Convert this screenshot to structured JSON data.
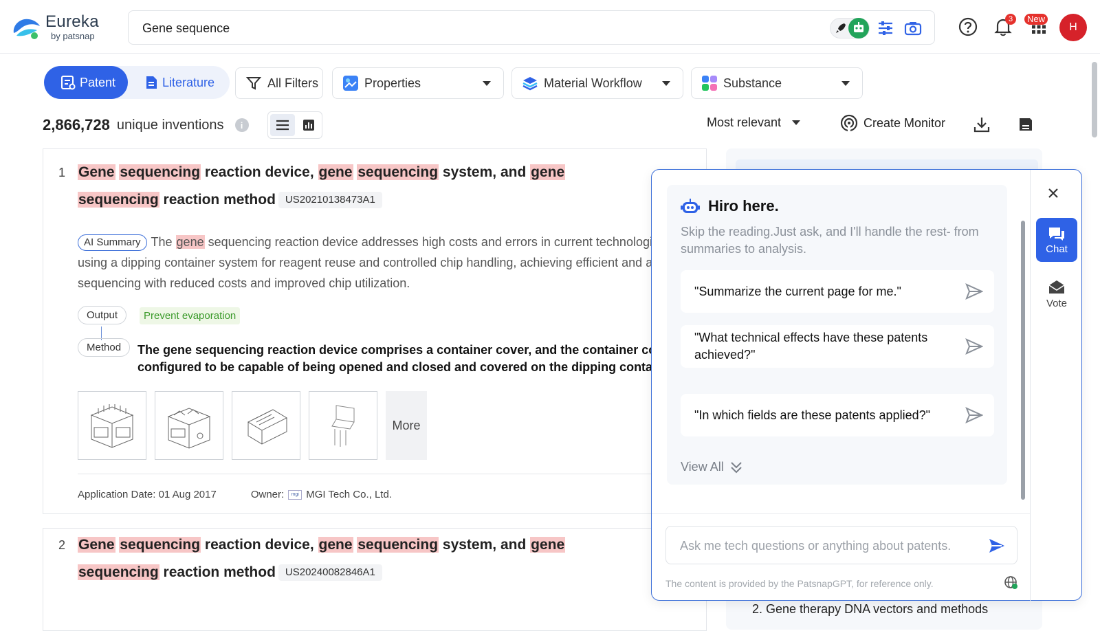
{
  "brand": {
    "name": "Eureka",
    "byline": "by patsnap"
  },
  "search": {
    "value": "Gene sequence"
  },
  "header": {
    "notification_count": "3",
    "apps_badge": "New",
    "avatar_initial": "H"
  },
  "toolbar": {
    "tabs": [
      {
        "label": "Patent",
        "active": true
      },
      {
        "label": "Literature",
        "active": false
      }
    ],
    "all_filters": "All Filters",
    "dropdowns": [
      "Properties",
      "Material Workflow",
      "Substance"
    ]
  },
  "results": {
    "count": "2,866,728",
    "count_label": "unique inventions",
    "sort": "Most relevant",
    "create_monitor": "Create Monitor",
    "items": [
      {
        "rank": "1",
        "title_parts": [
          {
            "t": "Gene",
            "hl": true
          },
          {
            "t": " ",
            "hl": false
          },
          {
            "t": "sequencing",
            "hl": true
          },
          {
            "t": " reaction device, ",
            "hl": false
          },
          {
            "t": "gene",
            "hl": true
          },
          {
            "t": " ",
            "hl": false
          },
          {
            "t": "sequencing",
            "hl": true
          },
          {
            "t": " system, and ",
            "hl": false
          },
          {
            "t": "gene",
            "hl": true
          },
          {
            "t": " ",
            "hl": false
          },
          {
            "t": "sequencing",
            "hl": true
          },
          {
            "t": " reaction method",
            "hl": false
          }
        ],
        "patent_number": "US20210138473A1",
        "ai_summary_label": "AI Summary",
        "summary_parts": [
          {
            "t": "The ",
            "hl": false
          },
          {
            "t": "gene",
            "hl": true
          },
          {
            "t": " sequencing reaction device addresses high costs and errors in current technologies using a dipping container system for reagent reuse and controlled chip handling, achieving efficient and acc",
            "hl": false
          },
          {
            "t": "gene",
            "hl": true
          },
          {
            "t": " sequencing with reduced costs and improved chip utilization.",
            "hl": false
          }
        ],
        "output_label": "Output",
        "output_value": "Prevent evaporation",
        "method_label": "Method",
        "method_text": "The gene sequencing reaction device comprises a container cover, and the container cove configured to be capable of being opened and closed and covered on the dipping contain",
        "more_label": "More",
        "application_date_label": "Application Date:",
        "application_date": "01 Aug 2017",
        "owner_label": "Owner:",
        "owner_logo_text": "mgi",
        "owner": "MGI Tech Co., Ltd."
      },
      {
        "rank": "2",
        "title_parts": [
          {
            "t": "Gene",
            "hl": true
          },
          {
            "t": " ",
            "hl": false
          },
          {
            "t": "sequencing",
            "hl": true
          },
          {
            "t": " reaction device, ",
            "hl": false
          },
          {
            "t": "gene",
            "hl": true
          },
          {
            "t": " ",
            "hl": false
          },
          {
            "t": "sequencing",
            "hl": true
          },
          {
            "t": " system, and ",
            "hl": false
          },
          {
            "t": "gene",
            "hl": true
          },
          {
            "t": " ",
            "hl": false
          },
          {
            "t": "sequencing",
            "hl": true
          },
          {
            "t": " reaction method",
            "hl": false
          }
        ],
        "patent_number": "US20240082846A1"
      }
    ]
  },
  "side_panel": {
    "underlying_item": "2. Gene therapy DNA vectors and methods"
  },
  "chat": {
    "title": "Hiro here.",
    "subtitle": "Skip the reading.Just ask, and I'll handle the rest- from summaries to analysis.",
    "suggestions": [
      "\"Summarize the current page for me.\"",
      "\"What technical effects have these patents achieved?\"",
      "\"In which fields are these patents applied?\""
    ],
    "view_all": "View All",
    "input_placeholder": "Ask me tech questions or anything about patents.",
    "disclaimer": "The content is provided by the PatsnapGPT, for reference only.",
    "rail": {
      "chat_label": "Chat",
      "vote_label": "Vote"
    }
  },
  "colors": {
    "accent": "#2f62e6",
    "highlight": "#f7c6c6",
    "green_tag": "#3a9a2a",
    "badge_red": "#e5322d",
    "avatar": "#d6222a"
  }
}
